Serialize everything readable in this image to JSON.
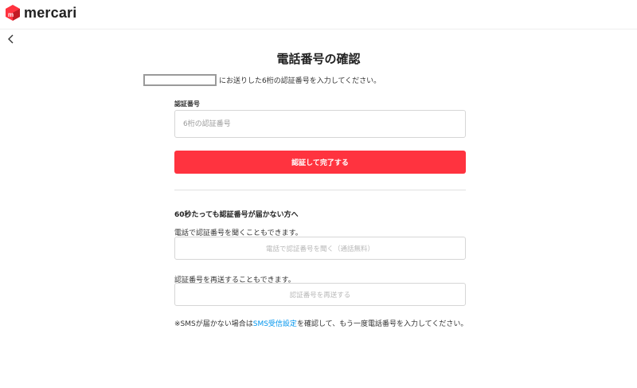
{
  "header": {
    "logo_text": "mercari",
    "logo_colors": {
      "red": "#ff333f",
      "dark_red": "#c21b24"
    }
  },
  "nav": {
    "back_icon": "chevron-left-icon"
  },
  "page": {
    "title": "電話番号の確認",
    "description": "にお送りした6桁の認証番号を入力してください。"
  },
  "form": {
    "code_label": "認証番号",
    "code_placeholder": "6桁の認証番号",
    "code_value": "",
    "submit_label": "認証して完了する"
  },
  "help": {
    "heading": "60秒たっても認証番号が届かない方へ",
    "call_text": "電話で認証番号を聞くこともできます。",
    "call_button": "電話で認証番号を聞く（通話無料）",
    "resend_text": "認証番号を再送することもできます。",
    "resend_button": "認証番号を再送する",
    "note_prefix": "※SMSが届かない場合は",
    "note_link": "SMS受信設定",
    "note_suffix": "を確認して、もう一度電話番号を入力してください。"
  },
  "colors": {
    "primary": "#ff333f",
    "link": "#0095ee"
  }
}
